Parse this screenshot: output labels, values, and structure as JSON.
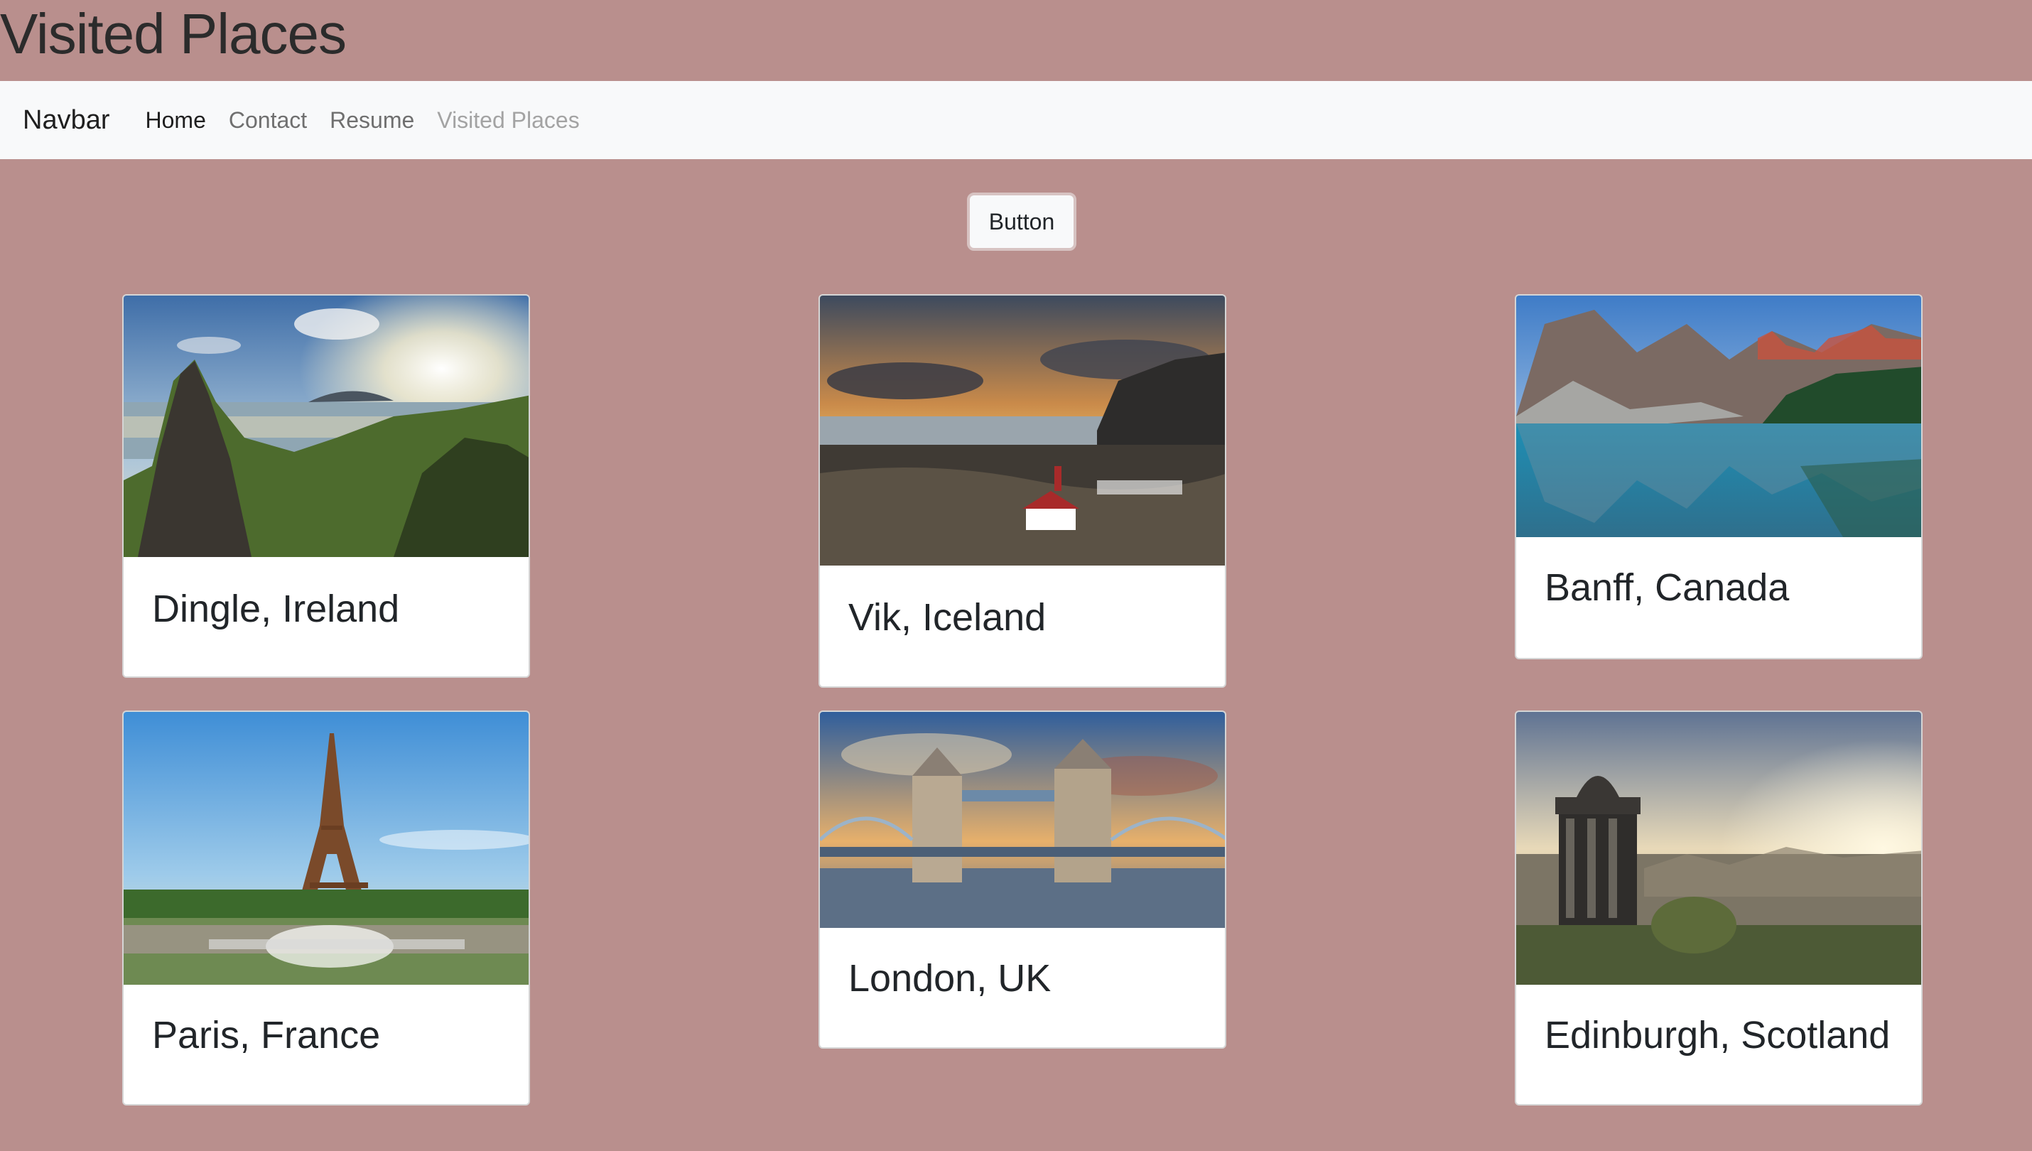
{
  "header": {
    "title": "Visited Places"
  },
  "navbar": {
    "brand": "Navbar",
    "links": [
      {
        "label": "Home",
        "state": "active"
      },
      {
        "label": "Contact",
        "state": "normal"
      },
      {
        "label": "Resume",
        "state": "normal"
      },
      {
        "label": "Visited Places",
        "state": "disabled"
      }
    ]
  },
  "main": {
    "button_label": "Button",
    "cards": [
      {
        "title": "Dingle, Ireland",
        "image": "coastal-cliffs-photo"
      },
      {
        "title": "Vik, Iceland",
        "image": "sunset-village-photo"
      },
      {
        "title": "Banff, Canada",
        "image": "mountain-lake-photo"
      },
      {
        "title": "Paris, France",
        "image": "eiffel-tower-photo"
      },
      {
        "title": "London, UK",
        "image": "tower-bridge-photo"
      },
      {
        "title": "Edinburgh, Scotland",
        "image": "city-monument-photo"
      }
    ]
  },
  "colors": {
    "page_background": "#b98f8d",
    "navbar_background": "#f8f9fa",
    "card_background": "#ffffff"
  }
}
